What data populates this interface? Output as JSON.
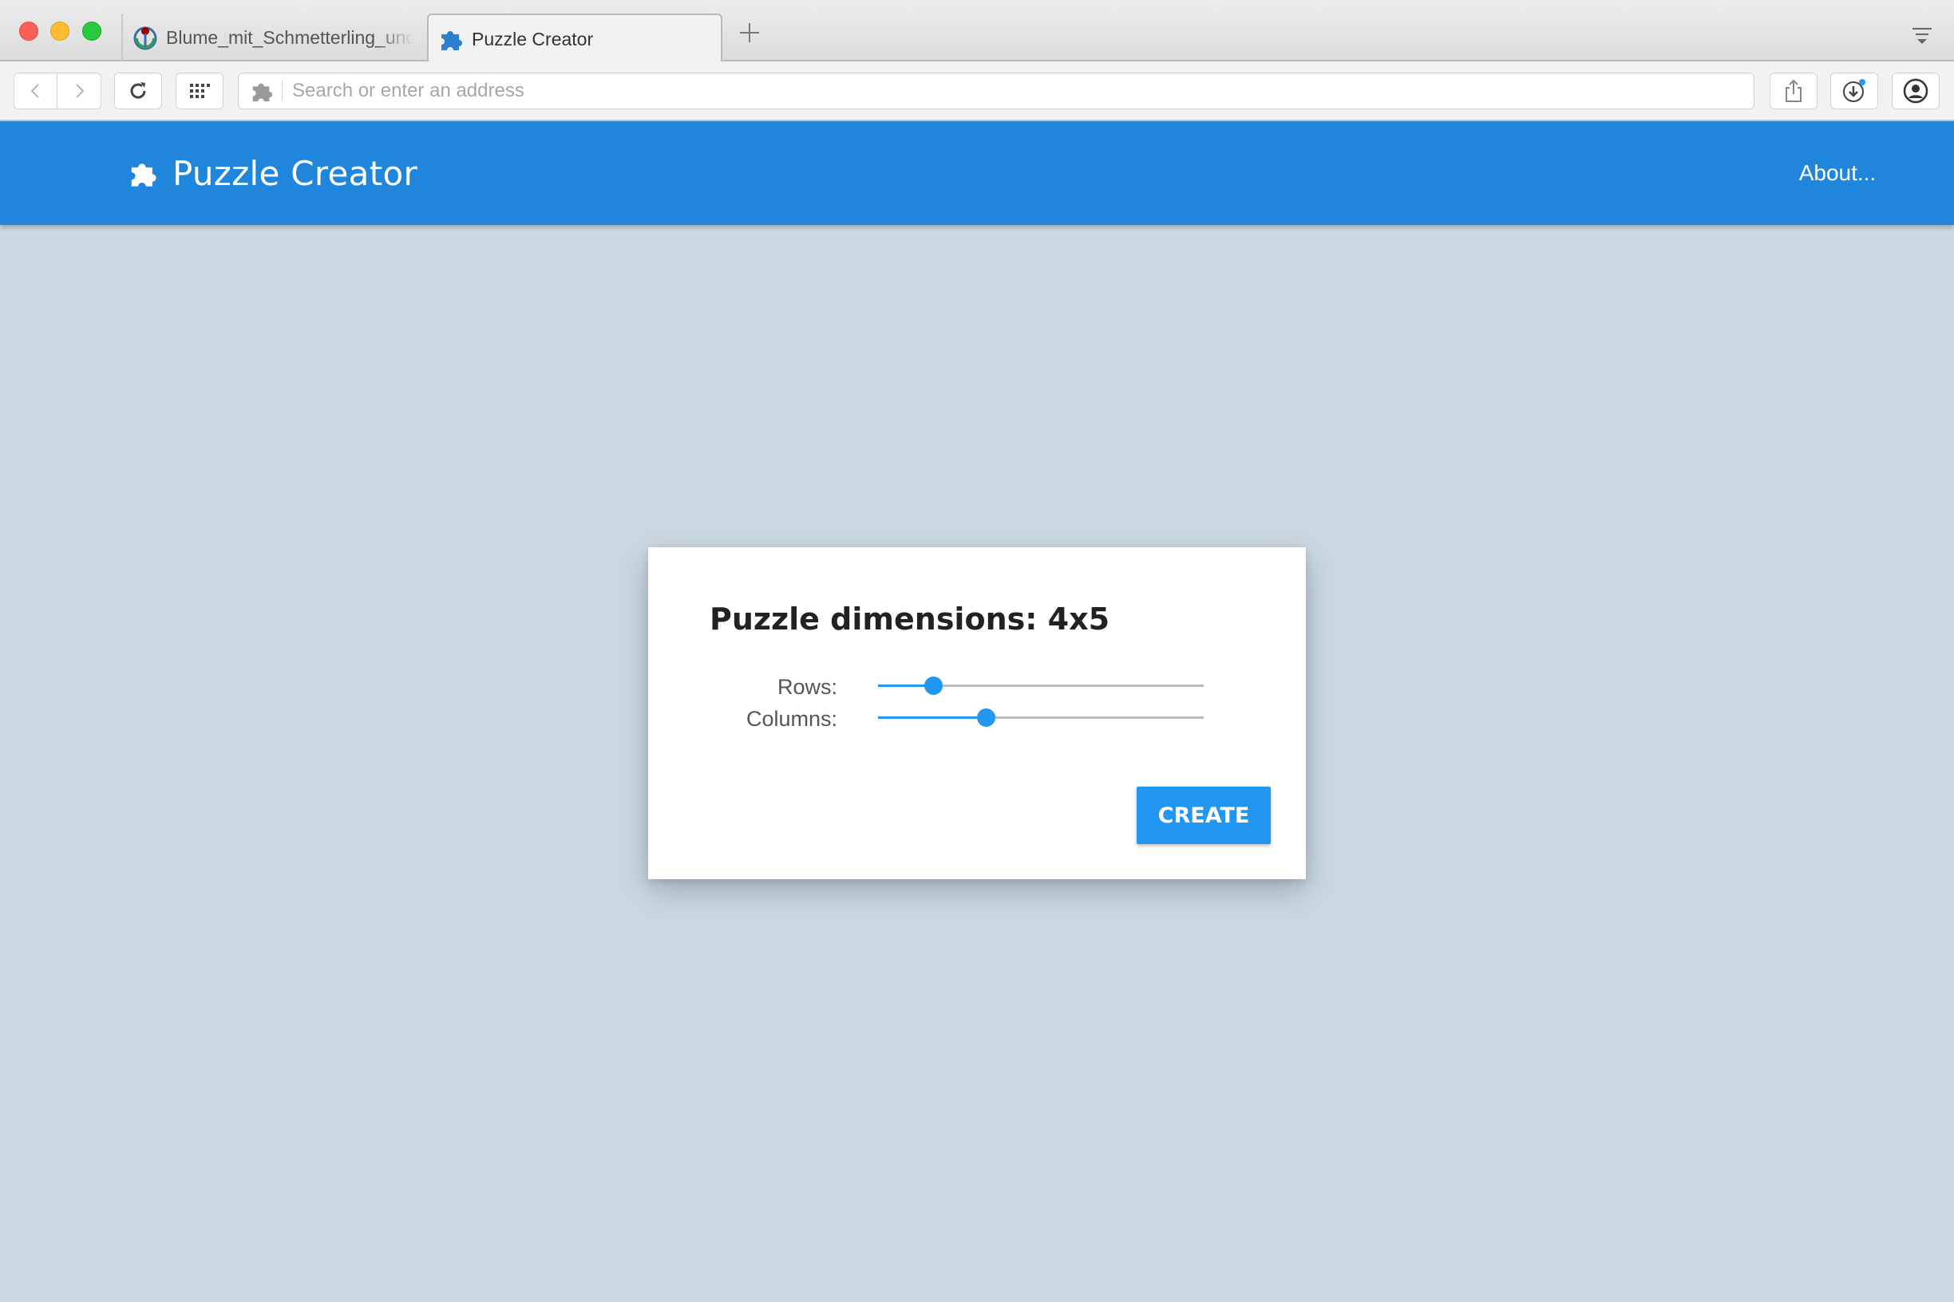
{
  "browser": {
    "tabs": [
      {
        "title": "Blume_mit_Schmetterling_und_Libelle",
        "icon": "wikimedia-icon",
        "active": false
      },
      {
        "title": "Puzzle Creator",
        "icon": "puzzle-icon",
        "active": true
      }
    ],
    "address_placeholder": "Search or enter an address",
    "address_value": ""
  },
  "app": {
    "title": "Puzzle Creator",
    "nav_about": "About...",
    "brand_color": "#2086dc",
    "background_color": "#cdd9e2"
  },
  "dialog": {
    "title": "Puzzle dimensions: 4x5",
    "rows_label": "Rows:",
    "columns_label": "Columns:",
    "rows_fraction": 0.17,
    "columns_fraction": 0.33,
    "create_label": "CREATE",
    "accent_color": "#2196f3"
  }
}
